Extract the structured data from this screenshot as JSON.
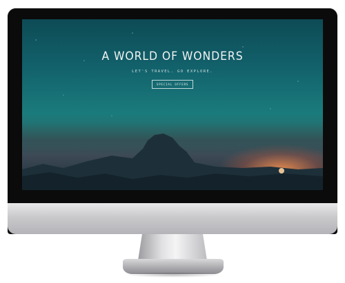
{
  "hero": {
    "title": "A WORLD OF WONDERS",
    "subtitle": "LET'S TRAVEL. GO EXPLORE.",
    "cta_label": "SPECIAL OFFERS"
  },
  "colors": {
    "sky_top": "#0d4b55",
    "sky_mid": "#1a7b7c",
    "sunset": "#ff9650",
    "mountain": "#14232b"
  }
}
